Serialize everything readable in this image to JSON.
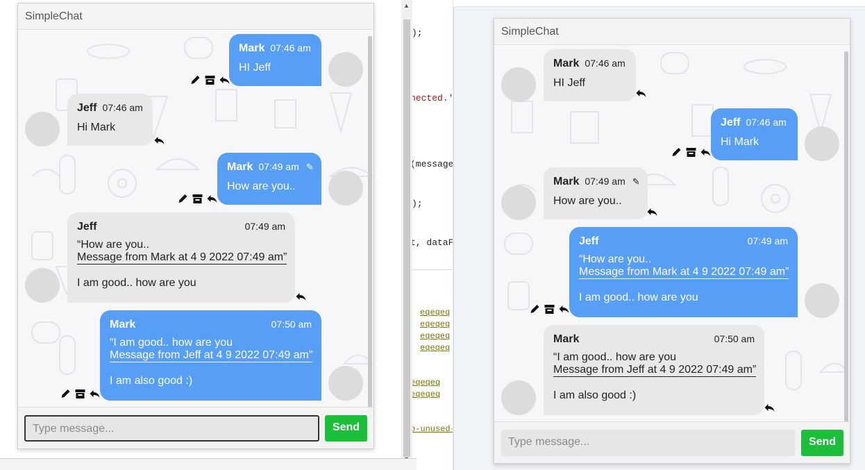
{
  "editor": {
    "line1": ");",
    "line2": "nected.'",
    "line3": "(message",
    "line4": ");",
    "line5": "t, dataF",
    "links": [
      "eqeqeq",
      "eqeqeq",
      "eqeqeq",
      "eqeqeq"
    ],
    "links2": [
      "eqeqeq",
      "eqeqeq"
    ],
    "footer_code": "o-unused-"
  },
  "left_chat": {
    "title": "SimpleChat",
    "input_placeholder": "Type message...",
    "send_label": "Send",
    "messages": [
      {
        "sender": "Mark",
        "time": "07:46 am",
        "text": "HI Jeff"
      },
      {
        "sender": "Jeff",
        "time": "07:46 am",
        "text": "Hi Mark"
      },
      {
        "sender": "Mark",
        "time": "07:49 am",
        "text": "How are you..",
        "edited": true
      },
      {
        "sender": "Jeff",
        "time": "07:49 am",
        "quote_line1": "“How are you..",
        "quote_line2": "Message from Mark at 4 9 2022 07:49 am”",
        "text": "I am good.. how are you"
      },
      {
        "sender": "Mark",
        "time": "07:50 am",
        "quote_line1": "“I am good.. how are you",
        "quote_line2": "Message from Jeff at 4 9 2022 07:49 am”",
        "text": "I am also good :)"
      }
    ]
  },
  "right_chat": {
    "title": "SimpleChat",
    "input_placeholder": "Type message...",
    "send_label": "Send",
    "messages": [
      {
        "sender": "Mark",
        "time": "07:46 am",
        "text": "HI Jeff"
      },
      {
        "sender": "Jeff",
        "time": "07:46 am",
        "text": "Hi Mark"
      },
      {
        "sender": "Mark",
        "time": "07:49 am",
        "text": "How are you..",
        "edited": true
      },
      {
        "sender": "Jeff",
        "time": "07:49 am",
        "quote_line1": "“How are you..",
        "quote_line2": "Message from Mark at 4 9 2022 07:49 am”",
        "text": "I am good.. how are you"
      },
      {
        "sender": "Mark",
        "time": "07:50 am",
        "quote_line1": "“I am good.. how are you",
        "quote_line2": "Message from Jeff at 4 9 2022 07:49 am”",
        "text": "I am also good :)"
      }
    ]
  },
  "colors": {
    "own_bubble": "#579ef7",
    "other_bubble": "#e8e8e8",
    "send_button": "#1bbf3a"
  },
  "icons": [
    "edit-pencil-icon",
    "archive-icon",
    "reply-icon",
    "edited-pencil-icon"
  ]
}
